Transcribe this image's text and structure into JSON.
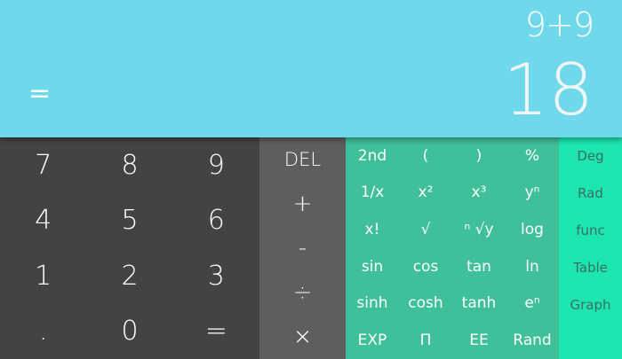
{
  "display": {
    "expression": "9+9",
    "result": "18",
    "equals_indicator": "="
  },
  "numpad": [
    "7",
    "8",
    "9",
    "4",
    "5",
    "6",
    "1",
    "2",
    "3",
    ".",
    "0",
    "="
  ],
  "operators": [
    "DEL",
    "+",
    "-",
    "÷",
    "×"
  ],
  "scientific": [
    "2nd",
    "(",
    ")",
    "%",
    "1/x",
    "x²",
    "x³",
    "yⁿ",
    "x!",
    "√",
    "ⁿ √y",
    "log",
    "sin",
    "cos",
    "tan",
    "ln",
    "sinh",
    "cosh",
    "tanh",
    "eⁿ",
    "EXP",
    "Π",
    "EE",
    "Rand"
  ],
  "modes": [
    "Deg",
    "Rad",
    "func",
    "Table",
    "Graph"
  ],
  "colors": {
    "display_bg": "#6fd8ea",
    "numpad_bg": "#434343",
    "operators_bg": "#5e5e5e",
    "scientific_bg": "#3fbf9a",
    "modes_bg": "#1de5b0"
  }
}
